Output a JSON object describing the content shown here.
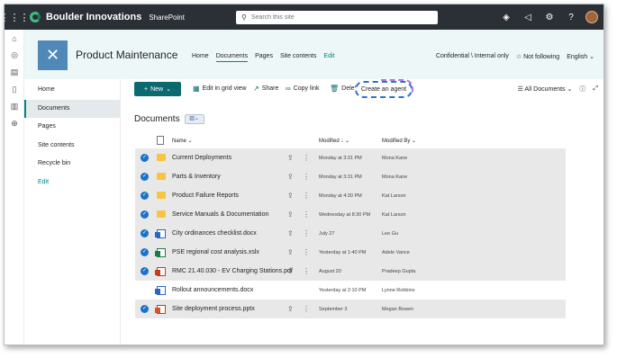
{
  "suitebar": {
    "org": "Boulder Innovations",
    "app": "SharePoint",
    "search_placeholder": "Search this site",
    "icons": [
      "waffle-icon",
      "copilot-icon",
      "megaphone-icon",
      "settings-icon",
      "help-icon",
      "avatar"
    ]
  },
  "site": {
    "title": "Product Maintenance",
    "nav": [
      "Home",
      "Documents",
      "Pages",
      "Site contents",
      "Edit"
    ],
    "nav_active": "Documents",
    "classification": "Confidential \\ Internal only",
    "follow": "Not following",
    "language": "English"
  },
  "leftnav": {
    "items": [
      "Home",
      "Documents",
      "Pages",
      "Site contents",
      "Recycle bin",
      "Edit"
    ],
    "active": "Documents"
  },
  "commandbar": {
    "new": "New",
    "edit_grid": "Edit in grid view",
    "share": "Share",
    "copy_link": "Copy link",
    "delete": "Delete",
    "create_agent": "Create an agent",
    "view": "All Documents"
  },
  "library": {
    "title": "Documents",
    "columns": {
      "name": "Name",
      "modified": "Modified",
      "modified_by": "Modified By"
    },
    "rows": [
      {
        "name": "Current Deployments",
        "type": "folder",
        "modified": "Monday at 3:31 PM",
        "by": "Mona Kane",
        "selected": true
      },
      {
        "name": "Parts & Inventory",
        "type": "folder",
        "modified": "Monday at 3:31 PM",
        "by": "Mona Kane",
        "selected": true
      },
      {
        "name": "Product Failure Reports",
        "type": "folder",
        "modified": "Monday at 4:30 PM",
        "by": "Kat Larson",
        "selected": true
      },
      {
        "name": "Service Manuals & Documentation",
        "type": "folder",
        "modified": "Wednesday at 8:30 PM",
        "by": "Kat Larson",
        "selected": true
      },
      {
        "name": "City ordinances checklist.docx",
        "type": "docx",
        "modified": "July 27",
        "by": "Lee Gu",
        "selected": true
      },
      {
        "name": "PSE regional cost analysis.xslx",
        "type": "xlsx",
        "modified": "Yesterday at 1:40 PM",
        "by": "Adele Vance",
        "selected": true
      },
      {
        "name": "RMC 21.40.030 - EV Charging Stations.pdf",
        "type": "pdf",
        "modified": "August 20",
        "by": "Pradeep Gupta",
        "selected": true
      },
      {
        "name": "Rollout announcements.docx",
        "type": "docx",
        "modified": "Yesterday at 2:10 PM",
        "by": "Lynne Robbins",
        "selected": false
      },
      {
        "name": "Site deployment process.pptx",
        "type": "pptx",
        "modified": "September 3",
        "by": "Megan Bowen",
        "selected": true
      }
    ]
  }
}
